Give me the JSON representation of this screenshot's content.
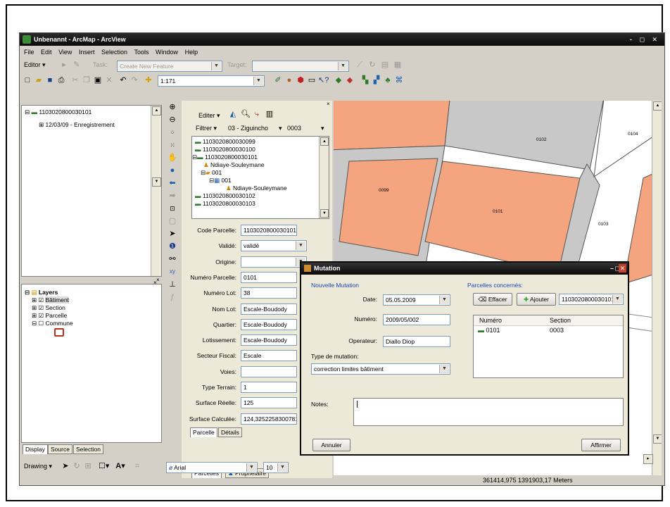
{
  "window": {
    "title": "Unbenannt - ArcMap - ArcView",
    "controls": "- ◻ ✕"
  },
  "menu": [
    "File",
    "Edit",
    "View",
    "Insert",
    "Selection",
    "Tools",
    "Window",
    "Help"
  ],
  "editor_toolbar": {
    "editor_label": "Editor ▾",
    "task_label": "Task:",
    "task_value": "Create New Feature",
    "target_label": "Target:",
    "target_value": ""
  },
  "standard_toolbar": {
    "scale": "1:171"
  },
  "toc_top": {
    "root": "1103020800030101",
    "child": "12/03/09 - Enregistrement"
  },
  "toc_tabs": [
    "Display",
    "Source",
    "Selection"
  ],
  "layers": {
    "title": "Layers",
    "items": [
      {
        "name": "Bâtiment",
        "checked": true,
        "highlight": true
      },
      {
        "name": "Section",
        "checked": true
      },
      {
        "name": "Parcelle",
        "checked": true
      },
      {
        "name": "Commune",
        "checked": false
      }
    ]
  },
  "editor_panel": {
    "edit_menu": "Editer ▾",
    "filter_label": "Filtrer ▾",
    "filter_region": "03 - Ziguincho",
    "filter_code": "0003",
    "tree": [
      {
        "text": "1103020800030099",
        "indent": 0
      },
      {
        "text": "1103020800030100",
        "indent": 0
      },
      {
        "text": "1103020800030101",
        "indent": 0
      },
      {
        "text": "Ndiaye-Souleymane",
        "indent": 1
      },
      {
        "text": "001",
        "indent": 1
      },
      {
        "text": "001",
        "indent": 2
      },
      {
        "text": "Ndiaye-Souleymane",
        "indent": 3
      },
      {
        "text": "1103020800030102",
        "indent": 0
      },
      {
        "text": "1103020800030103",
        "indent": 0
      }
    ],
    "form": [
      {
        "label": "Code Parcelle:",
        "value": "1103020800030101",
        "dropdown": false
      },
      {
        "label": "Validé:",
        "value": "validé",
        "dropdown": true
      },
      {
        "label": "Origine:",
        "value": "",
        "dropdown": true
      },
      {
        "label": "Numéro Parcelle:",
        "value": "0101",
        "dropdown": false
      },
      {
        "label": "Numéro Lot:",
        "value": "38",
        "dropdown": false
      },
      {
        "label": "Nom Lot:",
        "value": "Escale-Boudody",
        "dropdown": false
      },
      {
        "label": "Quartier:",
        "value": "Escale-Boudody",
        "dropdown": false
      },
      {
        "label": "Lotissement:",
        "value": "Escale-Boudody",
        "dropdown": false
      },
      {
        "label": "Secteur Fiscal:",
        "value": "Escale",
        "dropdown": false
      },
      {
        "label": "Voies:",
        "value": "",
        "dropdown": false
      },
      {
        "label": "Type Terrain:",
        "value": "1",
        "dropdown": false
      },
      {
        "label": "Surface Réelle:",
        "value": "125",
        "dropdown": false
      },
      {
        "label": "Surface Calculée:",
        "value": "124,3252258300781",
        "dropdown": false
      }
    ],
    "inner_tabs": [
      "Parcelle",
      "Détails"
    ],
    "bottom_tabs": [
      "Parcelles",
      "Proprietaire"
    ]
  },
  "map": {
    "labels": [
      "0102",
      "0104",
      "0099",
      "0101",
      "0103"
    ]
  },
  "mutation_dialog": {
    "title": "Mutation",
    "left_header": "Nouvelle Mutation",
    "date_label": "Date:",
    "date_value": "05.05.2009",
    "numero_label": "Numéro:",
    "numero_value": "2009/05/002",
    "operateur_label": "Operateur:",
    "operateur_value": "Diallo Diop",
    "type_label": "Type de mutation:",
    "type_value": "correction limites bâtiment",
    "right_header": "Parcelles concernés:",
    "effacer": "Effacer",
    "ajouter": "Ajouter",
    "parcel_select": "1103020800030101",
    "table_headers": [
      "Numéro",
      "Section"
    ],
    "table_rows": [
      {
        "numero": "0101",
        "section": "0003"
      }
    ],
    "notes_label": "Notes:",
    "cancel": "Annuler",
    "confirm": "Affirmer"
  },
  "drawing_toolbar": {
    "drawing": "Drawing ▾",
    "font": "Arial",
    "size": "10"
  },
  "status": {
    "coords": "361414,975  1391903,17 Meters"
  }
}
